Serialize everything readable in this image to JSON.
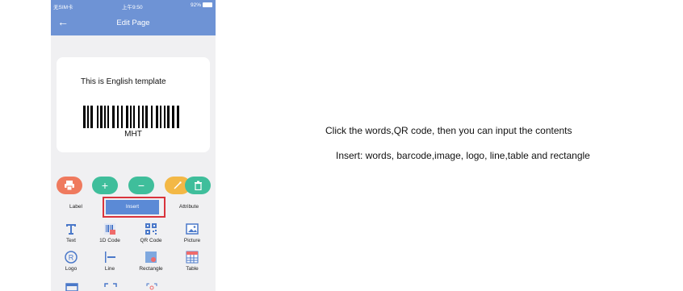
{
  "status_bar": {
    "carrier": "无SIM卡",
    "time": "上午9:50",
    "battery": "92%"
  },
  "nav": {
    "back_glyph": "←",
    "title": "Edit Page"
  },
  "canvas": {
    "text": "This is English template",
    "barcode_text": "MHT"
  },
  "tools": {
    "print_icon": "printer-icon",
    "add_glyph": "+",
    "remove_glyph": "−",
    "edit_icon": "magic-wand-icon",
    "delete_icon": "trash-icon"
  },
  "tabs": {
    "label": "Label",
    "insert": "Insert",
    "attribute": "Attribute"
  },
  "insert_items": [
    {
      "label": "Text",
      "icon": "text-icon"
    },
    {
      "label": "1D Code",
      "icon": "barcode-icon"
    },
    {
      "label": "QR Code",
      "icon": "qr-code-icon"
    },
    {
      "label": "Picture",
      "icon": "picture-icon"
    },
    {
      "label": "Logo",
      "icon": "registered-logo-icon"
    },
    {
      "label": "Line",
      "icon": "line-icon"
    },
    {
      "label": "Rectangle",
      "icon": "rectangle-icon"
    },
    {
      "label": "Table",
      "icon": "table-icon"
    }
  ],
  "notes": {
    "line1": "Click the words,QR code, then you can input the contents",
    "line2": "Insert: words, barcode,image, logo, line,table and rectangle"
  },
  "colors": {
    "primary": "#6e93d5",
    "tab_active": "#5b8ad6",
    "highlight": "#d9343c",
    "green": "#3fbe9b",
    "orange": "#ef7a5e",
    "yellow": "#f3b846"
  }
}
